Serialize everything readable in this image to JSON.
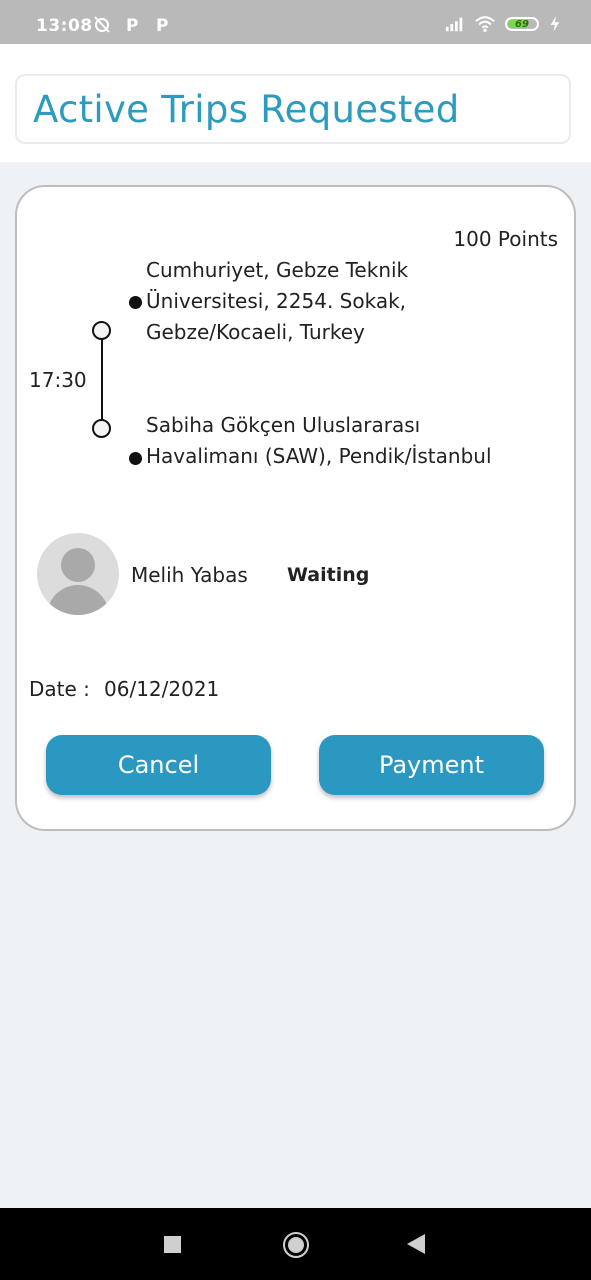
{
  "status_bar": {
    "time": "13:08",
    "battery_level": "69",
    "icons": [
      "alarm-off-icon",
      "parking-icon",
      "parking-icon",
      "signal-icon",
      "wifi-icon",
      "battery-icon",
      "charging-icon"
    ]
  },
  "header": {
    "title": "Active Trips Requested"
  },
  "trip": {
    "points": "100 Points",
    "time": "17:30",
    "origin": "Cumhuriyet, Gebze Teknik Üniversitesi, 2254. Sokak, Gebze/Kocaeli, Turkey",
    "destination": "Sabiha Gökçen Uluslararası Havalimanı (SAW), Pendik/İstanbul",
    "user_name": "Melih Yabas",
    "status": "Waiting",
    "date_label": "Date :",
    "date_value": "06/12/2021",
    "cancel_label": "Cancel",
    "payment_label": "Payment"
  },
  "colors": {
    "accent": "#2b98c1",
    "title": "#2b9bbf",
    "background": "#eef2f7"
  },
  "nav_bar": {
    "icons": [
      "recents-icon",
      "home-icon",
      "back-icon"
    ]
  }
}
